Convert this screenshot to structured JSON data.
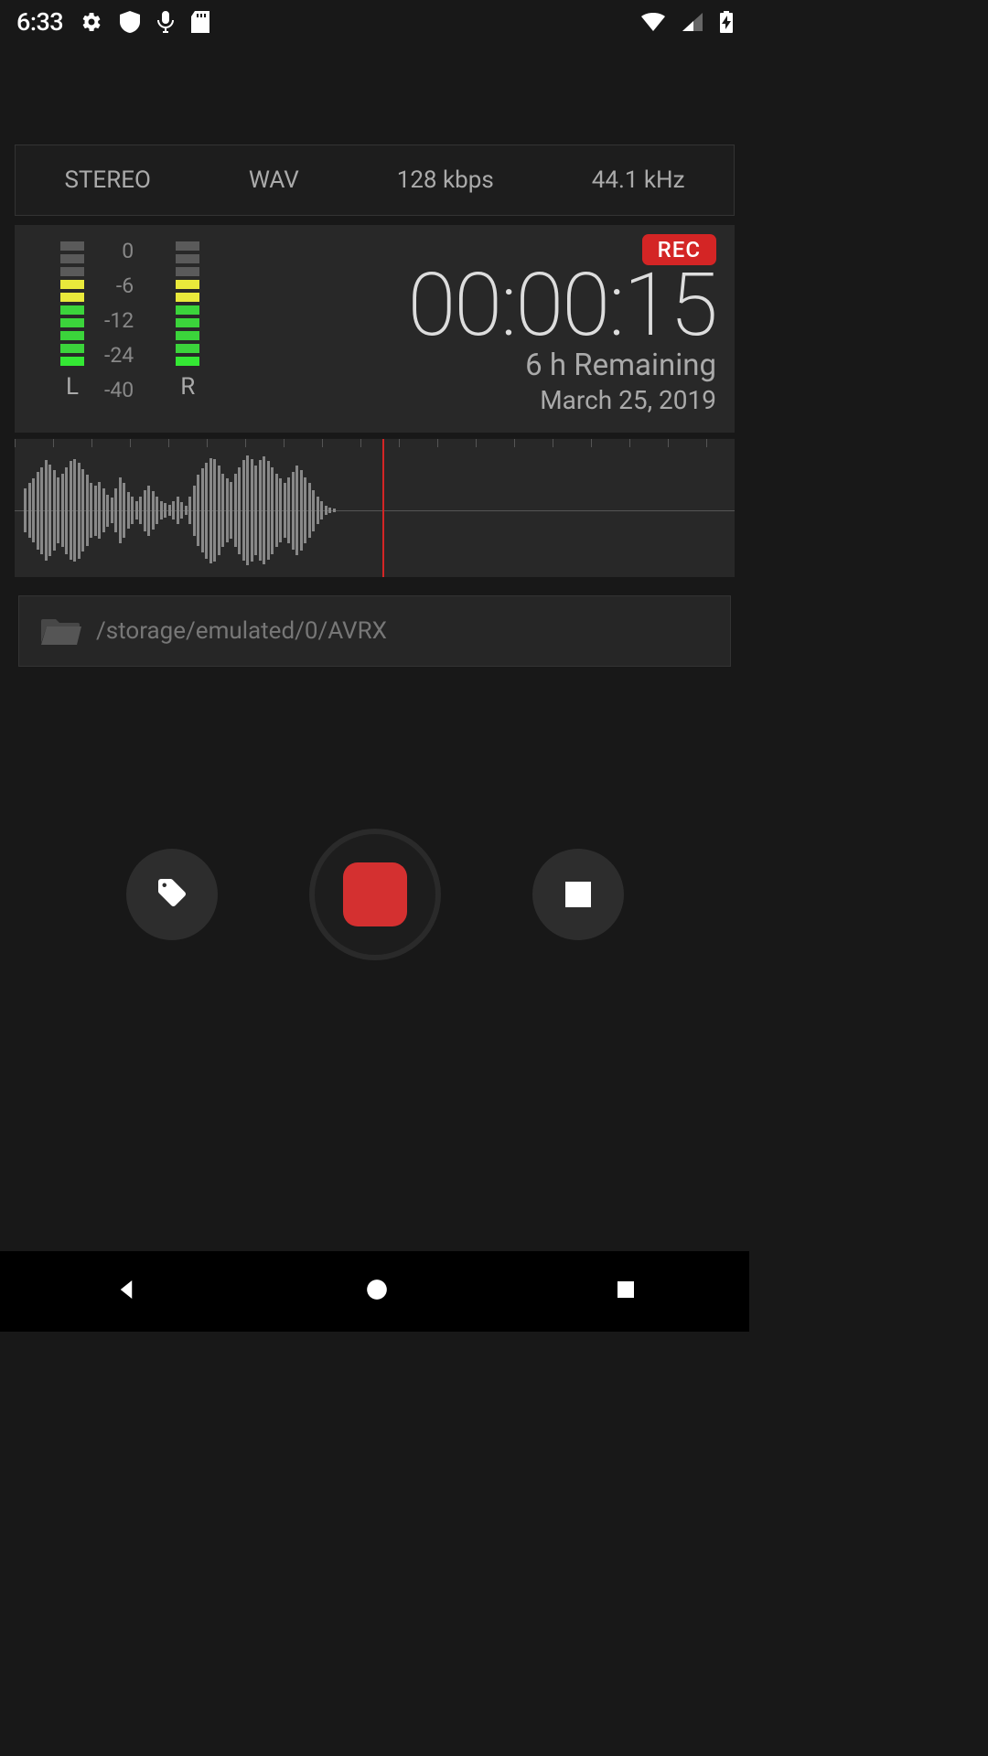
{
  "statusbar": {
    "time": "6:33"
  },
  "settings": {
    "channels": "STEREO",
    "format": "WAV",
    "bitrate": "128 kbps",
    "samplerate": "44.1 kHz"
  },
  "meter": {
    "labels": [
      "0",
      "-6",
      "-12",
      "-24",
      "-40"
    ],
    "channel_left": "L",
    "channel_right": "R"
  },
  "recording": {
    "badge": "REC",
    "time": "00:00:15",
    "remaining": "6 h Remaining",
    "date": "March 25, 2019"
  },
  "storage": {
    "path": "/storage/emulated/0/AVRX"
  },
  "waveform": {
    "heights": [
      48,
      60,
      70,
      85,
      95,
      110,
      100,
      88,
      72,
      80,
      95,
      108,
      112,
      105,
      90,
      78,
      60,
      55,
      62,
      48,
      35,
      28,
      48,
      72,
      60,
      40,
      30,
      20,
      30,
      45,
      55,
      42,
      30,
      20,
      16,
      12,
      20,
      30,
      18,
      10,
      30,
      55,
      78,
      92,
      105,
      115,
      112,
      98,
      80,
      70,
      62,
      80,
      95,
      110,
      120,
      112,
      98,
      110,
      118,
      108,
      95,
      80,
      70,
      60,
      72,
      85,
      98,
      88,
      72,
      60,
      45,
      30,
      20,
      10,
      6,
      4
    ]
  }
}
